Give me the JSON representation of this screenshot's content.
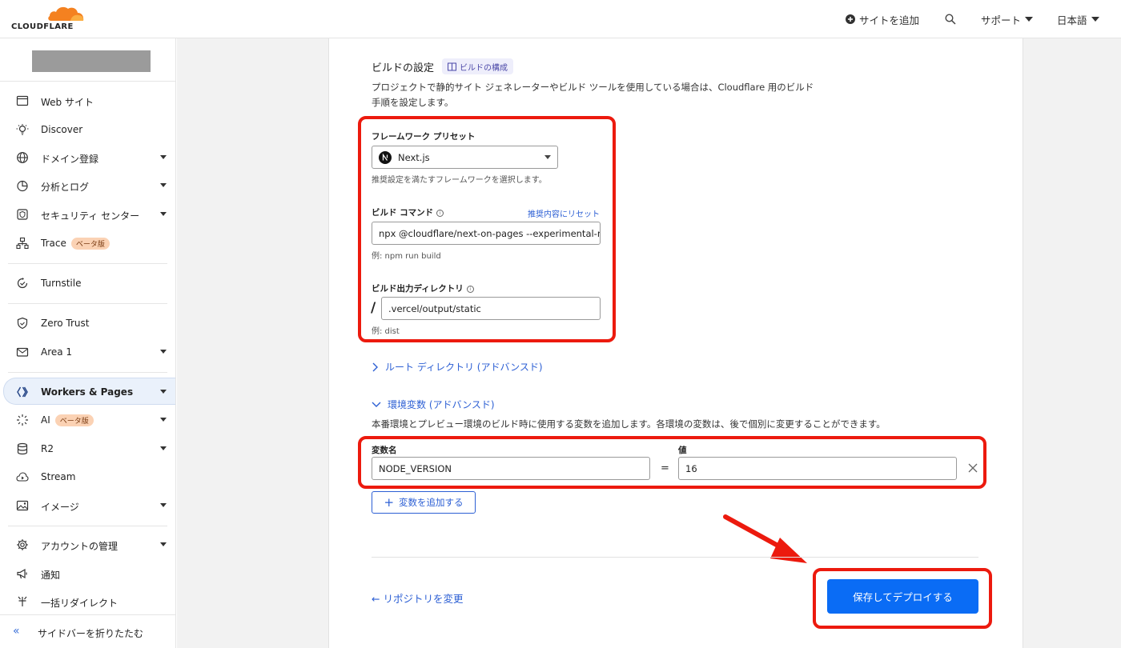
{
  "header": {
    "logo_text": "CLOUDFLARE",
    "add_site": "サイトを追加",
    "support": "サポート",
    "language": "日本語"
  },
  "sidebar": {
    "items": [
      {
        "label": "Web サイト",
        "icon": "browser-window-icon"
      },
      {
        "label": "Discover",
        "icon": "lightbulb-icon"
      },
      {
        "label": "ドメイン登録",
        "icon": "globe-icon",
        "expandable": true
      },
      {
        "label": "分析とログ",
        "icon": "pie-chart-icon",
        "expandable": true
      },
      {
        "label": "セキュリティ センター",
        "icon": "security-center-icon",
        "expandable": true
      },
      {
        "label": "Trace",
        "icon": "trace-icon",
        "badge": "ベータ版"
      },
      {
        "label": "Turnstile",
        "icon": "turnstile-icon"
      },
      {
        "label": "Zero Trust",
        "icon": "shield-icon"
      },
      {
        "label": "Area 1",
        "icon": "email-icon",
        "expandable": true
      },
      {
        "label": "Workers & Pages",
        "icon": "workers-icon",
        "expandable": true,
        "active": true
      },
      {
        "label": "AI",
        "icon": "ai-sparkle-icon",
        "badge": "ベータ版",
        "expandable": true
      },
      {
        "label": "R2",
        "icon": "database-icon",
        "expandable": true
      },
      {
        "label": "Stream",
        "icon": "cloud-play-icon"
      },
      {
        "label": "イメージ",
        "icon": "image-icon",
        "expandable": true
      },
      {
        "label": "アカウントの管理",
        "icon": "gear-icon",
        "expandable": true
      },
      {
        "label": "通知",
        "icon": "megaphone-icon"
      },
      {
        "label": "一括リダイレクト",
        "icon": "redirect-icon"
      }
    ],
    "collapse_label": "サイドバーを折りたたむ"
  },
  "build": {
    "title": "ビルドの設定",
    "config_pill": "ビルドの構成",
    "description": "プロジェクトで静的サイト ジェネレーターやビルド ツールを使用している場合は、Cloudflare 用のビルド手順を設定します。",
    "framework_label": "フレームワーク プリセット",
    "framework_value": "Next.js",
    "framework_help": "推奨設定を満たすフレームワークを選択します。",
    "command_label": "ビルド コマンド",
    "reset_link": "推奨内容にリセット",
    "command_value": "npx @cloudflare/next-on-pages --experimental-m",
    "command_example": "例: npm run build",
    "output_label": "ビルド出力ディレクトリ",
    "output_prefix": "/",
    "output_value": ".vercel/output/static",
    "output_example": "例: dist"
  },
  "root_dir": {
    "label": "ルート ディレクトリ (アドバンスド)"
  },
  "env": {
    "label": "環境変数 (アドバンスド)",
    "description": "本番環境とプレビュー環境のビルド時に使用する変数を追加します。各環境の変数は、後で個別に変更することができます。",
    "name_label": "変数名",
    "value_label": "値",
    "name_value": "NODE_VERSION",
    "equals": "=",
    "value_value": "16",
    "add_button": "変数を追加する"
  },
  "footer": {
    "change_repo": "リポジトリを変更",
    "save_deploy": "保存してデプロイする"
  },
  "colors": {
    "accent": "#0a6cf5",
    "link": "#2c5fd4",
    "highlight": "#ec1a0e",
    "brand_orange": "#f48120"
  }
}
